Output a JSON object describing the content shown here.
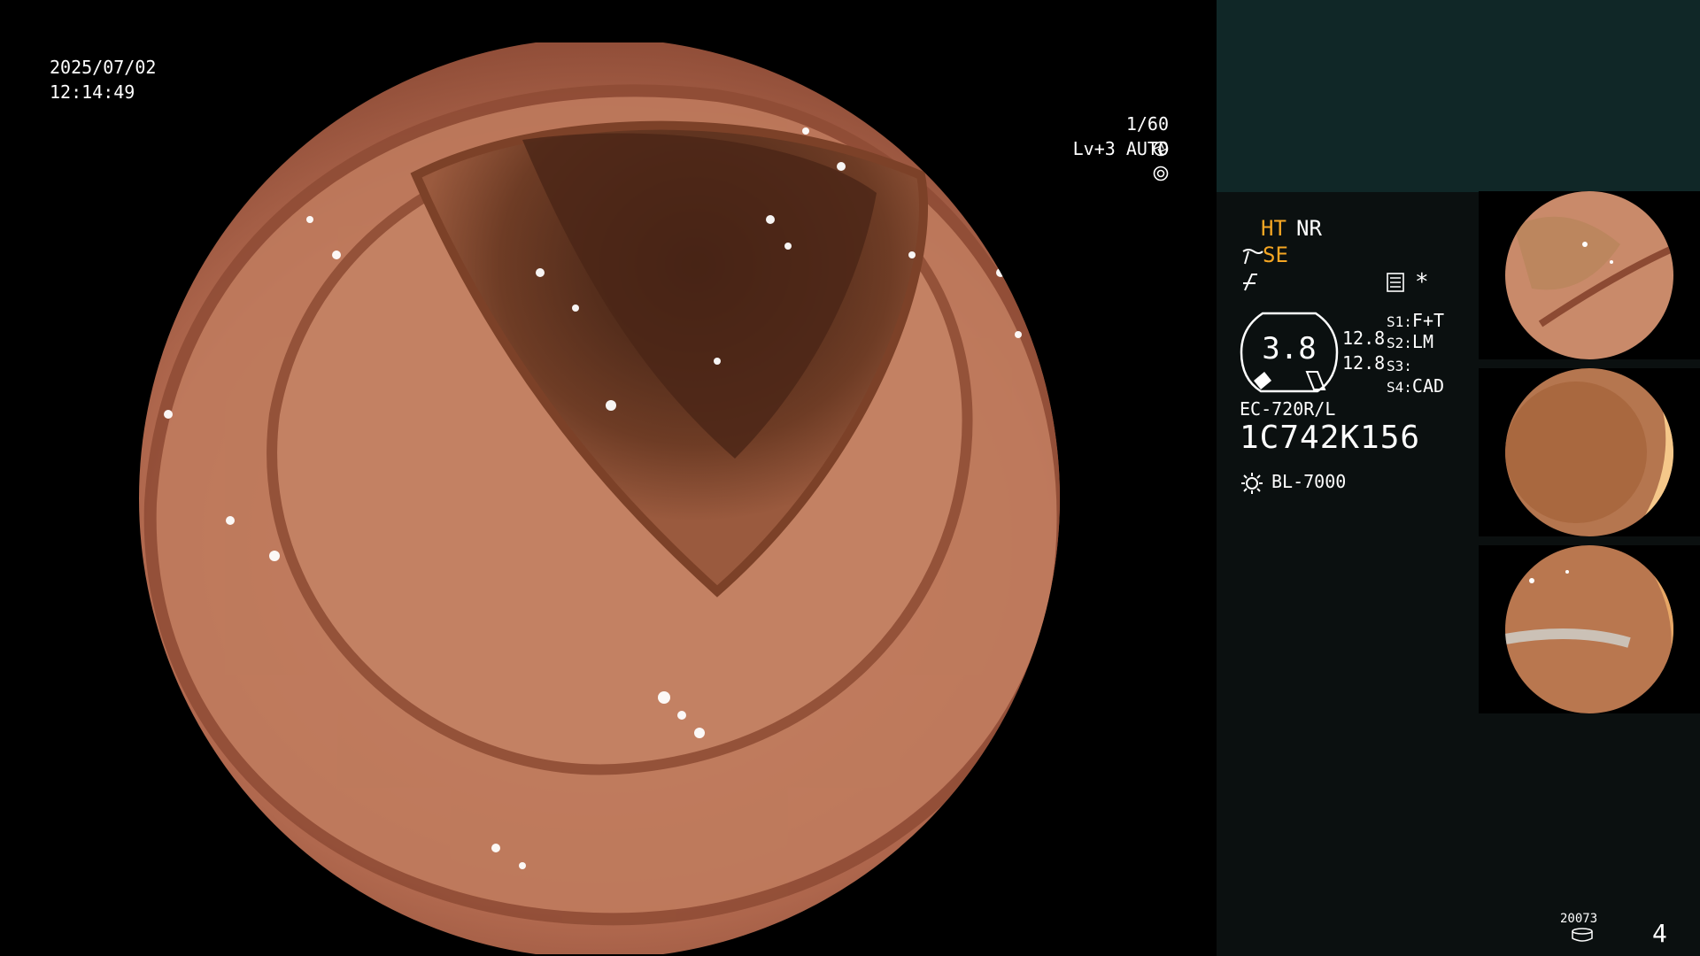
{
  "overlay": {
    "date": "2025/07/02",
    "time": "12:14:49",
    "shutter": "1/60",
    "level": "Lv+3 AUTO"
  },
  "panel": {
    "ht": "HT",
    "nr": "NR",
    "se": "SE",
    "gauge_value": "3.8",
    "value_top": "12.8",
    "value_bottom": "12.8",
    "s1_label": "S1:",
    "s1_value": "F+T",
    "s2_label": "S2:",
    "s2_value": "LM",
    "s3_label": "S3:",
    "s3_value": "",
    "s4_label": "S4:",
    "s4_value": "CAD",
    "star": "*",
    "scope_model": "EC-720R/L",
    "serial": "1C742K156",
    "light_source": "BL-7000",
    "counter_code": "20073",
    "page_number": "4"
  },
  "colors": {
    "accent_orange": "#f5a623",
    "panel_top": "#102727",
    "panel_bg": "#0b1010"
  },
  "icons": {
    "shutter": "aperture-icon",
    "level": "iris-icon",
    "se": "structure-enhancement-icon",
    "fx": "color-mode-icon",
    "chart": "menu-chart-icon",
    "light": "light-source-icon",
    "counter": "storage-icon"
  }
}
